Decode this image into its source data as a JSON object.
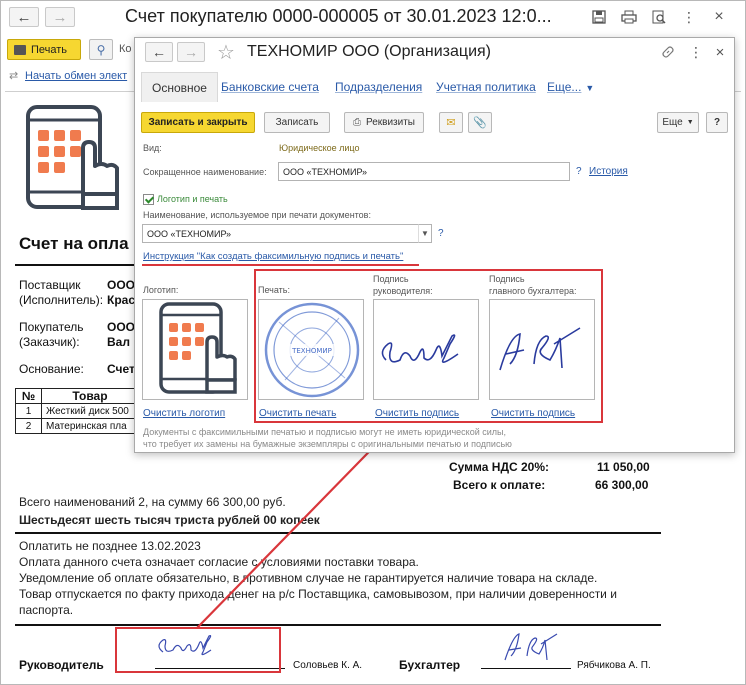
{
  "window": {
    "title": "Счет покупателю 0000-000005 от 30.01.2023 12:0...",
    "print_label": "Печать",
    "toolbar_cut_label": "Ко",
    "exchange_link": "Начать обмен элект"
  },
  "doc": {
    "title": "Счет на опла",
    "supplier_label": "Поставщик\n(Исполнитель):",
    "supplier_value_1": "ООО",
    "supplier_value_2": "Крас",
    "buyer_label": "Покупатель\n(Заказчик):",
    "buyer_value_1": "ООО",
    "buyer_value_2": "Вал",
    "basis_label": "Основание:",
    "basis_value": "Счет",
    "table": {
      "col_num": "№",
      "col_goods": "Товар",
      "rows": [
        {
          "num": "1",
          "name": "Жесткий диск 500"
        },
        {
          "num": "2",
          "name": "Материнская пла"
        }
      ]
    },
    "vat_label": "Сумма НДС 20%:",
    "vat_value": "11 050,00",
    "total_label": "Всего к оплате:",
    "total_value": "66 300,00",
    "line_items": "Всего наименований 2, на сумму 66 300,00 руб.",
    "line_words": "Шестьдесят шесть тысяч триста рублей 00 копеек",
    "pay_by": "Оплатить не позднее 13.02.2023",
    "cond_1": "Оплата данного счета означает согласие с условиями поставки товара.",
    "cond_2": "Уведомление об оплате обязательно, в противном случае не гарантируется наличие товара на складе.",
    "cond_3": "Товар отпускается по факту прихода денег на р/с Поставщика, самовывозом, при наличии доверенности и",
    "cond_4": "паспорта.",
    "head_label": "Руководитель",
    "head_name": "Соловьев К. А.",
    "acc_label": "Бухгалтер",
    "acc_name": "Рябчикова А. П."
  },
  "dialog": {
    "title": "ТЕХНОМИР ООО (Организация)",
    "tabs": [
      {
        "label": "Основное"
      },
      {
        "label": "Банковские счета"
      },
      {
        "label": "Подразделения"
      },
      {
        "label": "Учетная политика"
      },
      {
        "label": "Еще..."
      }
    ],
    "btn_save_close": "Записать и закрыть",
    "btn_save": "Записать",
    "btn_requisites": "Реквизиты",
    "btn_more": "Еще",
    "btn_help": "?",
    "kind_label": "Вид:",
    "kind_value": "Юридическое лицо",
    "short_name_label": "Сокращенное наименование:",
    "short_name_value": "ООО «ТЕХНОМИР»",
    "history_link": "История",
    "logo_section": "Логотип и печать",
    "print_name_label": "Наименование, используемое при печати документов:",
    "print_name_value": "ООО «ТЕХНОМИР»",
    "instruction_link": "Инструкция \"Как создать факсимильную подпись и печать\"",
    "logo_label": "Логотип:",
    "stamp_label": "Печать:",
    "head_sign_label": "Подпись\nруководителя:",
    "acc_sign_label": "Подпись\nглавного бухгалтера:",
    "clear_logo": "Очистить логотип",
    "clear_stamp": "Очистить печать",
    "clear_sign_1": "Очистить подпись",
    "clear_sign_2": "Очистить подпись",
    "note_1": "Документы с факсимильными печатью и подписью могут не иметь юридической силы,",
    "note_2": "что требует их замены на бумажные экземпляры с оригинальными печатью и подписью",
    "stamp_text": "ТЕХНОМИР"
  },
  "colors": {
    "accent_yellow": "#f6d731",
    "link_blue": "#2a5aa8",
    "highlight_red": "#d9363b",
    "logo_orange": "#f07b4e",
    "logo_dark": "#3c4654"
  }
}
